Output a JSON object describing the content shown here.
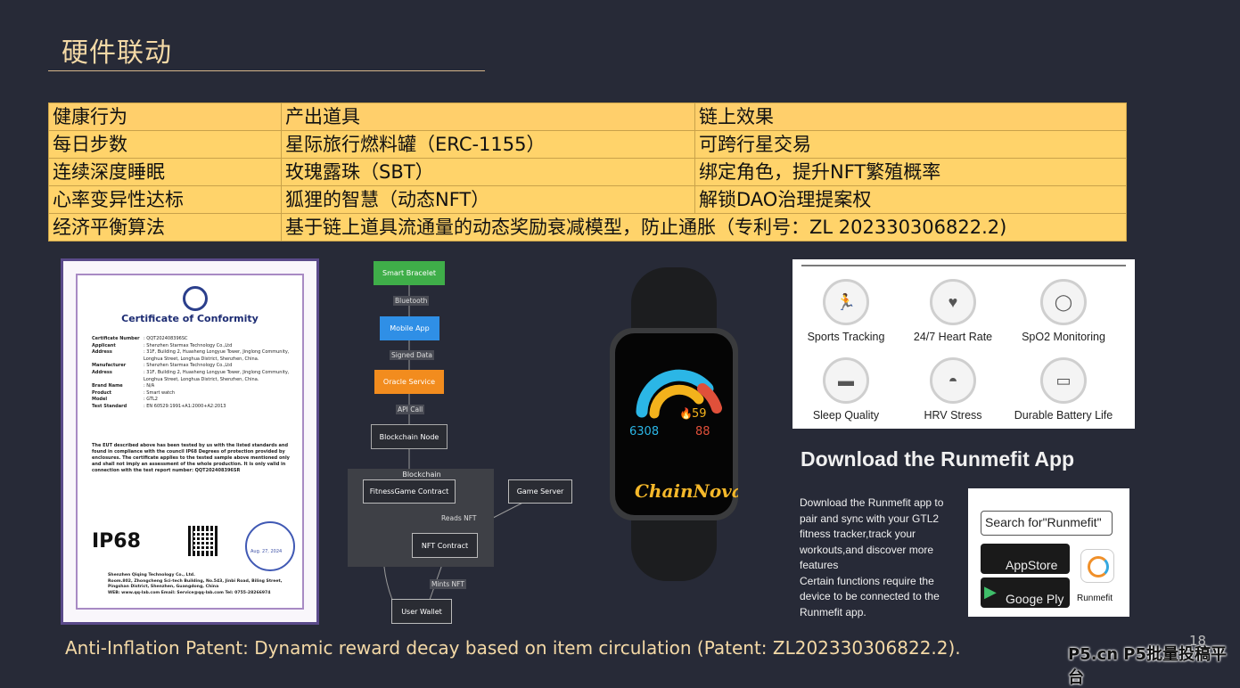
{
  "page": {
    "title": "硬件联动",
    "footer": "Anti-Inflation Patent: Dynamic reward decay based on item circulation (Patent: ZL202330306822.2).",
    "page_number": "18",
    "watermark": "P5.cn P5批量投稿平台"
  },
  "table": {
    "header": [
      "健康行为",
      "产出道具",
      "链上效果"
    ],
    "rows": [
      [
        "每日步数",
        "星际旅行燃料罐（ERC-1155）",
        "可跨行星交易"
      ],
      [
        "连续深度睡眠",
        "玫瑰露珠（SBT）",
        "绑定角色，提升NFT繁殖概率"
      ],
      [
        "心率变异性达标",
        "狐狸的智慧（动态NFT）",
        "解锁DAO治理提案权"
      ]
    ],
    "last_row": {
      "label": "经济平衡算法",
      "value": "基于链上道具流通量的动态奖励衰减模型，防止通胀（专利号：ZL 202330306822.2)"
    }
  },
  "certificate": {
    "title": "Certificate of Conformity",
    "fields": [
      {
        "k": "Certificate Number",
        "v": ": QQT202408396SC"
      },
      {
        "k": "Applicant",
        "v": ": Shenzhen Starmax Technology Co.,Ltd"
      },
      {
        "k": "Address",
        "v": ": 31F, Building 2, Huasheng Longyue Tower, Jinglong Community, Longhua Street, Longhua District, Shenzhen, China."
      },
      {
        "k": "Manufacturer",
        "v": ": Shenzhen Starmax Technology Co.,Ltd"
      },
      {
        "k": "Address",
        "v": ": 31F, Building 2, Huasheng Longyue Tower, Jinglong Community, Longhua Street, Longhua District, Shenzhen, China."
      },
      {
        "k": "Brand Name",
        "v": ": N/A"
      },
      {
        "k": "Product",
        "v": ": Smart watch"
      },
      {
        "k": "Model",
        "v": ": GTL2"
      },
      {
        "k": "Test Standard",
        "v": ": EN 60529:1991+A1:2000+A2:2013"
      }
    ],
    "body": "The EUT described above has been tested by us with the listed standards and found in compliance with the council IP68 Degrees of protection provided by enclosures. The certificate applies to the tested sample above mentioned only and shall not imply an assessment of the whole production. It is only valid in connection with the test report number: QQT202408396SR",
    "rating": "IP68",
    "seal_date": "Aug. 27, 2024",
    "issuer": "Shenzhen Qiqing Technology Co., Ltd.",
    "issuer_address": "Room.802, Zhongcheng Sci-tech Building, No.543, Jinbi Road, Biling Street, Pingshan District, Shenzhen, Guangdong, China",
    "issuer_contact": "WEB: www.qq-lab.com    Email: Service@qq-lab.com    Tel: 0755-28266974"
  },
  "diagram": {
    "nodes": {
      "smart_bracelet": "Smart Bracelet",
      "mobile_app": "Mobile App",
      "oracle": "Oracle Service",
      "blockchain_node": "Blockchain Node",
      "blockchain_group": "Blockchain",
      "fitness_contract": "FitnessGame Contract",
      "game_server": "Game Server",
      "nft_contract": "NFT Contract",
      "user_wallet": "User Wallet"
    },
    "edges": {
      "bluetooth": "Bluetooth",
      "signed_data": "Signed Data",
      "api_call": "API Call",
      "reads_nft": "Reads NFT",
      "mints_nft": "Mints NFT"
    },
    "colors": {
      "green": "#3fae49",
      "blue": "#2f8fe6",
      "orange": "#f28c1e"
    }
  },
  "watch": {
    "steps": "6308",
    "calories": "59",
    "heart_rate": "88",
    "brand": "ChainNova"
  },
  "features": [
    {
      "label": "Sports Tracking",
      "icon": "running-icon"
    },
    {
      "label": "24/7 Heart Rate",
      "icon": "heart-icon"
    },
    {
      "label": "SpO2 Monitoring",
      "icon": "ring-icon"
    },
    {
      "label": "Sleep Quality",
      "icon": "bed-icon"
    },
    {
      "label": "HRV Stress",
      "icon": "stress-icon"
    },
    {
      "label": "Durable Battery Life",
      "icon": "battery-icon"
    }
  ],
  "download": {
    "title": "Download the Runmefit App",
    "text1": "Download the Runmefit app to pair and sync with your GTL2 fitness tracker,track your workouts,and discover more features",
    "text2": "Certain functions require the device to be connected to the Runmefit app.",
    "search": "Search for\"Runmefit\"",
    "appstore": "AppStore",
    "googleplay": "Googe Ply",
    "app_name": "Runmefit"
  }
}
